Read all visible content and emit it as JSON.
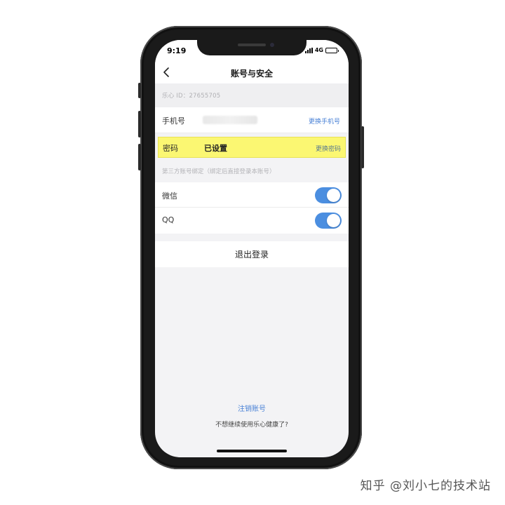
{
  "status_bar": {
    "time": "9:19",
    "network": "4G",
    "battery_level": 0.85
  },
  "nav": {
    "title": "账号与安全"
  },
  "account": {
    "id_text": "乐心 ID：27655705"
  },
  "phone_row": {
    "label": "手机号",
    "action": "更换手机号"
  },
  "password_row": {
    "label": "密码",
    "status": "已设置",
    "action": "更换密码",
    "highlight_color": "#fbf772"
  },
  "third_party": {
    "header": "第三方账号绑定（绑定后直接登录本账号）",
    "items": [
      {
        "label": "微信",
        "enabled": true
      },
      {
        "label": "QQ",
        "enabled": true
      }
    ]
  },
  "logout": {
    "label": "退出登录"
  },
  "footer": {
    "cancel_link": "注销账号",
    "hint": "不想继续使用乐心健康了?"
  },
  "watermark": "知乎 @刘小七的技术站",
  "colors": {
    "accent": "#4a82d6",
    "toggle_on": "#4b8ee0",
    "background": "#f3f3f5"
  }
}
